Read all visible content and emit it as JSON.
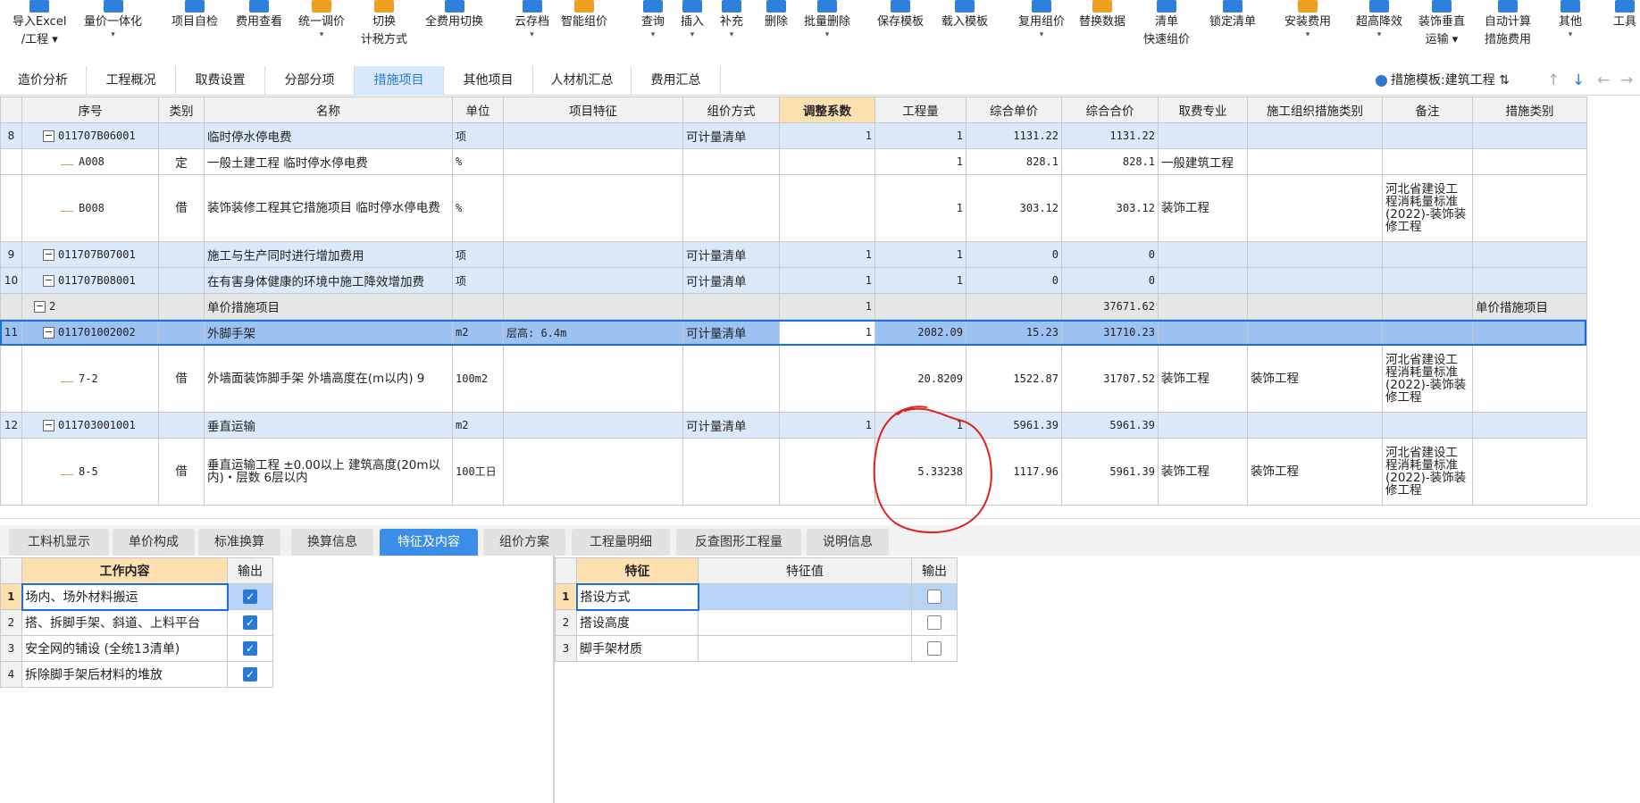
{
  "toolbar": {
    "import_excel": "导入Excel",
    "import_excel_sub": "/工程",
    "price_integration": "量价一体化",
    "project_check": "项目自检",
    "fee_view": "费用查看",
    "unified_adjust": "统一调价",
    "switch": "切换",
    "switch_sub": "计税方式",
    "full_fee_switch": "全费用切换",
    "cloud_save": "云存档",
    "smart_price": "智能组价",
    "query": "查询",
    "insert": "插入",
    "supplement": "补充",
    "delete": "删除",
    "batch_delete": "批量删除",
    "save_template": "保存模板",
    "load_template": "载入模板",
    "reuse_price": "复用组价",
    "replace_data": "替换数据",
    "clear_list": "清单",
    "clear_list_sub": "快速组价",
    "lock_list": "锁定清单",
    "install_fee": "安装费用",
    "super_height": "超高降效",
    "decor_vertical": "装饰垂直",
    "decor_vertical_sub": "运输",
    "auto_calc": "自动计算",
    "auto_calc_sub": "措施费用",
    "other": "其他",
    "tools": "工具"
  },
  "tabs": [
    "造价分析",
    "工程概况",
    "取费设置",
    "分部分项",
    "措施项目",
    "其他项目",
    "人材机汇总",
    "费用汇总"
  ],
  "active_tab": "措施项目",
  "template_label": "措施模板:建筑工程",
  "grid": {
    "headers": [
      "序号",
      "类别",
      "名称",
      "单位",
      "项目特征",
      "组价方式",
      "调整系数",
      "工程量",
      "综合单价",
      "综合合价",
      "取费专业",
      "施工组织措施类别",
      "备注",
      "措施类别"
    ],
    "rows": [
      {
        "rn": "8",
        "code": "011707B06001",
        "cat": "",
        "name": "临时停水停电费",
        "unit": "项",
        "feature": "",
        "method": "可计量清单",
        "coef": "1",
        "qty": "1",
        "price": "1131.22",
        "total": "1131.22",
        "major": "",
        "org": "",
        "remark": "",
        "mcat": ""
      },
      {
        "rn": "",
        "code": "A008",
        "cat": "定",
        "name": "一般土建工程 临时停水停电费",
        "unit": "%",
        "feature": "",
        "method": "",
        "coef": "",
        "qty": "1",
        "price": "828.1",
        "total": "828.1",
        "major": "一般建筑工程",
        "org": "",
        "remark": "",
        "mcat": ""
      },
      {
        "rn": "",
        "code": "B008",
        "cat": "借",
        "name": "装饰装修工程其它措施项目 临时停水停电费",
        "unit": "%",
        "feature": "",
        "method": "",
        "coef": "",
        "qty": "1",
        "price": "303.12",
        "total": "303.12",
        "major": "装饰工程",
        "org": "",
        "remark": "河北省建设工程消耗量标准(2022)-装饰装修工程",
        "mcat": ""
      },
      {
        "rn": "9",
        "code": "011707B07001",
        "cat": "",
        "name": "施工与生产同时进行增加费用",
        "unit": "项",
        "feature": "",
        "method": "可计量清单",
        "coef": "1",
        "qty": "1",
        "price": "0",
        "total": "0",
        "major": "",
        "org": "",
        "remark": "",
        "mcat": ""
      },
      {
        "rn": "10",
        "code": "011707B08001",
        "cat": "",
        "name": "在有害身体健康的环境中施工降效增加费",
        "unit": "项",
        "feature": "",
        "method": "可计量清单",
        "coef": "1",
        "qty": "1",
        "price": "0",
        "total": "0",
        "major": "",
        "org": "",
        "remark": "",
        "mcat": ""
      },
      {
        "rn": "",
        "code": "2",
        "cat": "",
        "name": "单价措施项目",
        "unit": "",
        "feature": "",
        "method": "",
        "coef": "1",
        "qty": "",
        "price": "",
        "total": "37671.62",
        "major": "",
        "org": "",
        "remark": "",
        "mcat": "单价措施项目"
      },
      {
        "rn": "11",
        "code": "011701002002",
        "cat": "",
        "name": "外脚手架",
        "unit": "m2",
        "feature": "层高: 6.4m",
        "method": "可计量清单",
        "coef": "1",
        "qty": "2082.09",
        "price": "15.23",
        "total": "31710.23",
        "major": "",
        "org": "",
        "remark": "",
        "mcat": ""
      },
      {
        "rn": "",
        "code": "7-2",
        "cat": "借",
        "name": "外墙面装饰脚手架 外墙高度在(m以内) 9",
        "unit": "100m2",
        "feature": "",
        "method": "",
        "coef": "",
        "qty": "20.8209",
        "price": "1522.87",
        "total": "31707.52",
        "major": "装饰工程",
        "org": "装饰工程",
        "remark": "河北省建设工程消耗量标准(2022)-装饰装修工程",
        "mcat": ""
      },
      {
        "rn": "12",
        "code": "011703001001",
        "cat": "",
        "name": "垂直运输",
        "unit": "m2",
        "feature": "",
        "method": "可计量清单",
        "coef": "1",
        "qty": "1",
        "price": "5961.39",
        "total": "5961.39",
        "major": "",
        "org": "",
        "remark": "",
        "mcat": ""
      },
      {
        "rn": "",
        "code": "8-5",
        "cat": "借",
        "name": "垂直运输工程 ±0.00以上 建筑高度(20m以内)・层数 6层以内",
        "unit": "100工日",
        "feature": "",
        "method": "",
        "coef": "",
        "qty": "5.33238",
        "price": "1117.96",
        "total": "5961.39",
        "major": "装饰工程",
        "org": "装饰工程",
        "remark": "河北省建设工程消耗量标准(2022)-装饰装修工程",
        "mcat": ""
      }
    ]
  },
  "bottom_tabs": [
    "工料机显示",
    "单价构成",
    "标准换算",
    "换算信息",
    "特征及内容",
    "组价方案",
    "工程量明细",
    "反查图形工程量",
    "说明信息"
  ],
  "active_bottom_tab": "特征及内容",
  "work_content": {
    "headers": [
      "工作内容",
      "输出"
    ],
    "rows": [
      {
        "rn": "1",
        "text": "场内、场外材料搬运",
        "checked": true
      },
      {
        "rn": "2",
        "text": "搭、拆脚手架、斜道、上料平台",
        "checked": true
      },
      {
        "rn": "3",
        "text": "安全网的铺设 (全统13清单)",
        "checked": true
      },
      {
        "rn": "4",
        "text": "拆除脚手架后材料的堆放",
        "checked": true
      }
    ]
  },
  "features": {
    "headers": [
      "特征",
      "特征值",
      "输出"
    ],
    "rows": [
      {
        "rn": "1",
        "name": "搭设方式",
        "value": "",
        "checked": false
      },
      {
        "rn": "2",
        "name": "搭设高度",
        "value": "",
        "checked": false
      },
      {
        "rn": "3",
        "name": "脚手架材质",
        "value": "",
        "checked": false
      }
    ]
  },
  "colors": {
    "accent": "#2a7ad5",
    "annotation": "#e0201a",
    "header_highlight": "#fde0b0",
    "row_blue": "#dce9fb",
    "row_selected": "#9dc2f2"
  }
}
